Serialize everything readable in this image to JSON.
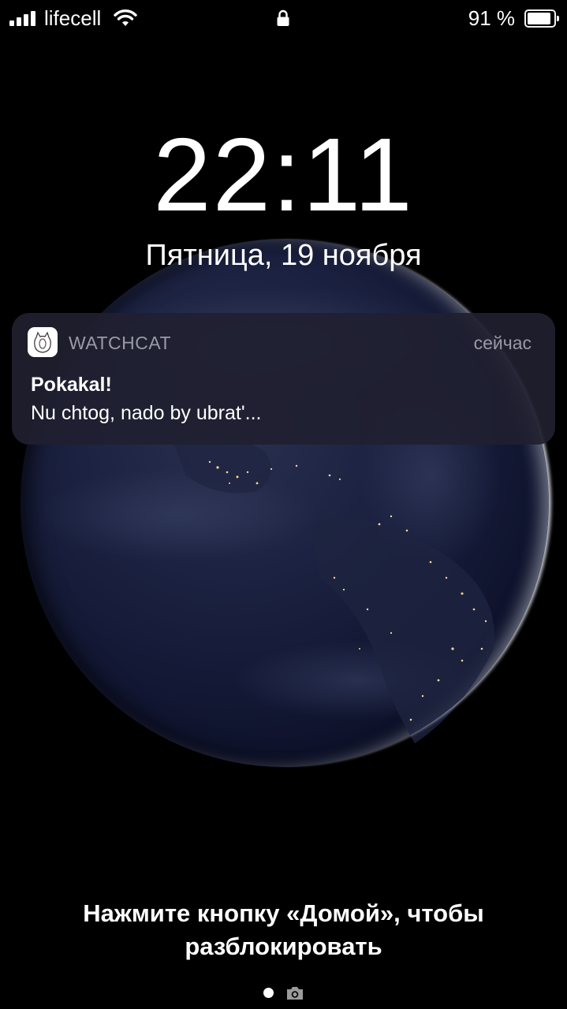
{
  "status_bar": {
    "carrier": "lifecell",
    "battery_percent_text": "91 %",
    "battery_level": 0.91,
    "signal_bars": 4,
    "icons": [
      "signal-icon",
      "wifi-icon",
      "lock-icon",
      "battery-icon"
    ]
  },
  "lock_screen": {
    "time": "22:11",
    "date": "Пятница, 19 ноября"
  },
  "notification": {
    "app_name": "WATCHCAT",
    "timestamp": "сейчас",
    "title": "Pokakal!",
    "body": "Nu chtog, nado by ubrat'...",
    "icon": "watchcat-app-icon"
  },
  "bottom": {
    "unlock_hint_line1": "Нажмите кнопку «Домой», чтобы",
    "unlock_hint_line2": "разблокировать",
    "icons": [
      "page-indicator-dot",
      "camera-icon"
    ]
  },
  "colors": {
    "background": "#000000",
    "notification_bg": "#20202f",
    "secondary_text": "#9a9aa6"
  }
}
